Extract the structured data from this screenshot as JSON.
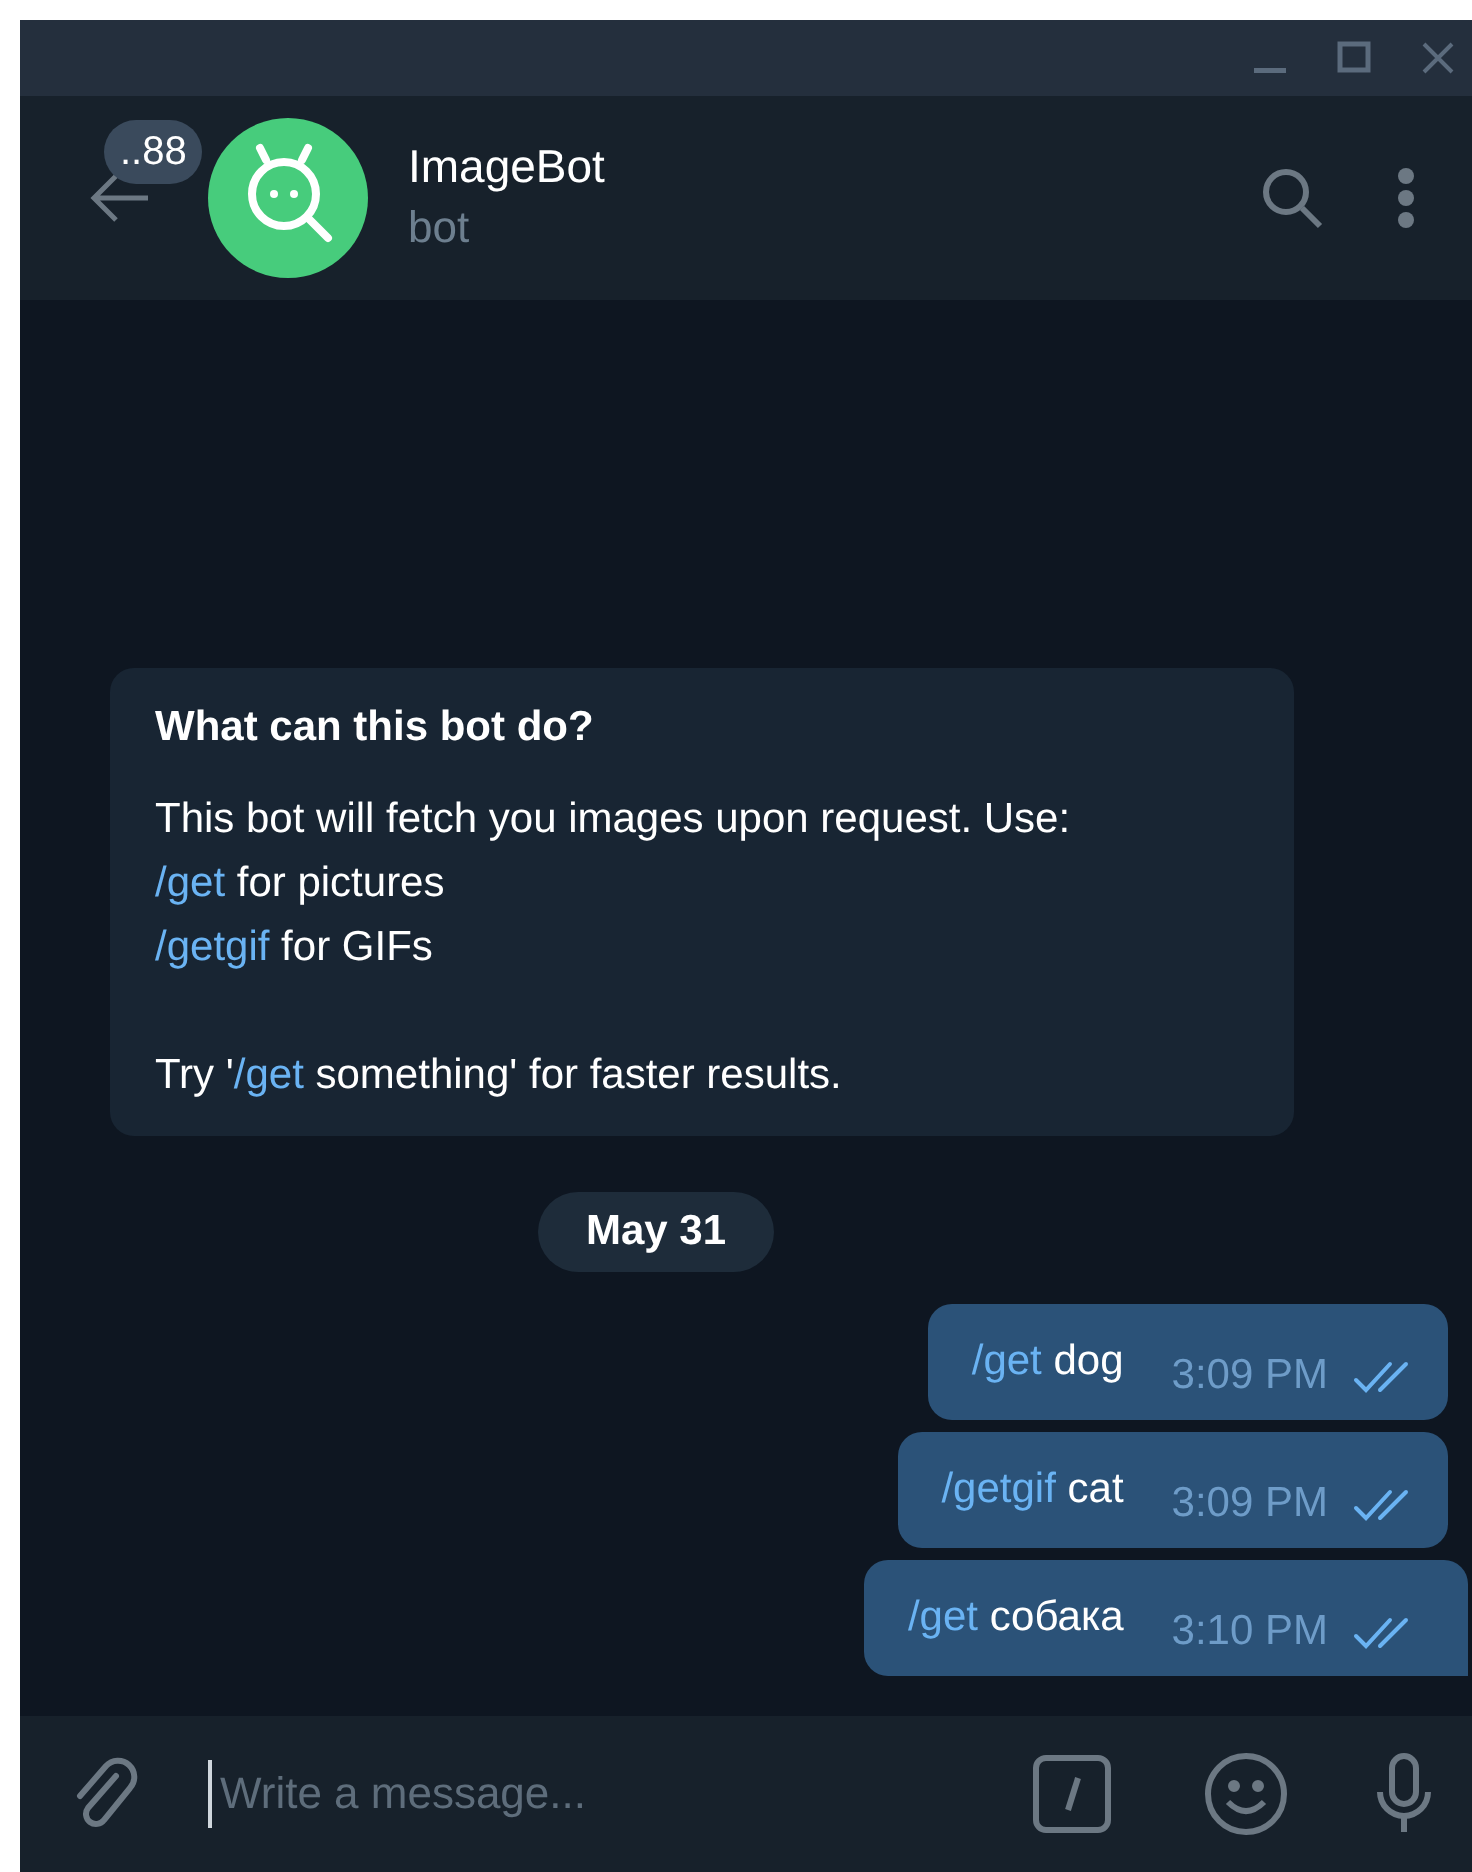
{
  "header": {
    "back_badge": "..88",
    "title": "ImageBot",
    "subtitle": "bot"
  },
  "intro": {
    "title": "What can this bot do?",
    "paragraphs": [
      [
        [
          {
            "kind": "text",
            "text": "This bot will fetch you images upon request. Use:"
          }
        ],
        [
          {
            "kind": "command",
            "text": "/get"
          },
          {
            "kind": "text",
            "text": " for pictures"
          }
        ],
        [
          {
            "kind": "command",
            "text": "/getgif"
          },
          {
            "kind": "text",
            "text": " for GIFs"
          }
        ]
      ],
      [
        [
          {
            "kind": "text",
            "text": "Try '"
          },
          {
            "kind": "command",
            "text": "/get"
          },
          {
            "kind": "text",
            "text": " something' for faster results."
          }
        ]
      ]
    ]
  },
  "date": "May 31",
  "messages": [
    {
      "command": "/get",
      "text": "dog",
      "time": "3:09 PM",
      "read": true,
      "tail": false
    },
    {
      "command": "/getgif",
      "text": "cat",
      "time": "3:09 PM",
      "read": true,
      "tail": false
    },
    {
      "command": "/get",
      "text": "собака",
      "time": "3:10 PM",
      "read": true,
      "tail": true
    }
  ],
  "composer": {
    "placeholder": "Write a message..."
  }
}
